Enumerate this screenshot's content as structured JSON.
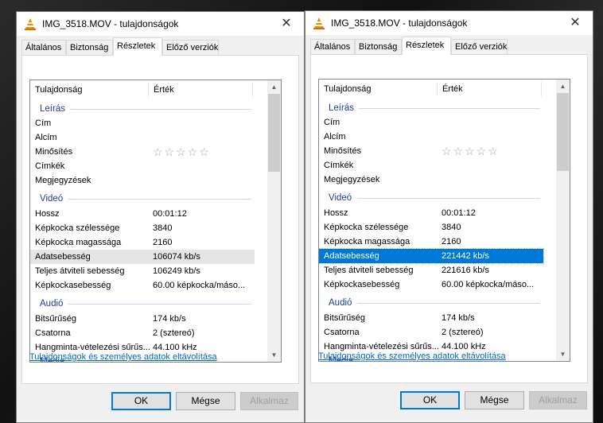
{
  "dialogs": [
    {
      "title": "IMG_3518.MOV - tulajdonságok",
      "close_glyph": "✕",
      "tabs": [
        "Általános",
        "Biztonság",
        "Részletek",
        "Előző verziók"
      ],
      "active_tab": "Részletek",
      "columns": [
        "Tulajdonság",
        "Érték"
      ],
      "groups": {
        "description": "Leírás",
        "video": "Videó",
        "audio": "Audió",
        "partial": "Media"
      },
      "description_rows": [
        {
          "key": "Cím",
          "value": ""
        },
        {
          "key": "Alcím",
          "value": ""
        },
        {
          "key": "Minősítés",
          "value": "☆☆☆☆☆"
        },
        {
          "key": "Címkék",
          "value": ""
        },
        {
          "key": "Megjegyzések",
          "value": ""
        }
      ],
      "video_rows": [
        {
          "key": "Hossz",
          "value": "00:01:12"
        },
        {
          "key": "Képkocka szélessége",
          "value": "3840"
        },
        {
          "key": "Képkocka magassága",
          "value": "2160"
        },
        {
          "key": "Adatsebesség",
          "value": "106074 kb/s"
        },
        {
          "key": "Teljes átviteli sebesség",
          "value": "106249 kb/s"
        },
        {
          "key": "Képkockasebesség",
          "value": "60.00 képkocka/máso..."
        }
      ],
      "audio_rows": [
        {
          "key": "Bitsűrűség",
          "value": "174 kb/s"
        },
        {
          "key": "Csatorna",
          "value": "2 (sztereó)"
        },
        {
          "key": "Hangminta-vételezési sűrűs...",
          "value": "44.100 kHz"
        }
      ],
      "link": "Tulajdonságok és személyes adatok eltávolítása",
      "buttons": {
        "ok": "OK",
        "cancel": "Mégse",
        "apply": "Alkalmaz"
      }
    },
    {
      "title": "IMG_3518.MOV - tulajdonságok",
      "close_glyph": "✕",
      "tabs": [
        "Általános",
        "Biztonság",
        "Részletek",
        "Előző verziók"
      ],
      "active_tab": "Részletek",
      "columns": [
        "Tulajdonság",
        "Érték"
      ],
      "groups": {
        "description": "Leírás",
        "video": "Videó",
        "audio": "Audió",
        "partial": "Media"
      },
      "description_rows": [
        {
          "key": "Cím",
          "value": ""
        },
        {
          "key": "Alcím",
          "value": ""
        },
        {
          "key": "Minősítés",
          "value": "☆☆☆☆☆"
        },
        {
          "key": "Címkék",
          "value": ""
        },
        {
          "key": "Megjegyzések",
          "value": ""
        }
      ],
      "video_rows": [
        {
          "key": "Hossz",
          "value": "00:01:12"
        },
        {
          "key": "Képkocka szélessége",
          "value": "3840"
        },
        {
          "key": "Képkocka magassága",
          "value": "2160"
        },
        {
          "key": "Adatsebesség",
          "value": "221442 kb/s"
        },
        {
          "key": "Teljes átviteli sebesség",
          "value": "221616 kb/s"
        },
        {
          "key": "Képkockasebesség",
          "value": "60.00 képkocka/máso..."
        }
      ],
      "audio_rows": [
        {
          "key": "Bitsűrűség",
          "value": "174 kb/s"
        },
        {
          "key": "Csatorna",
          "value": "2 (sztereó)"
        },
        {
          "key": "Hangminta-vételezési sűrűs...",
          "value": "44.100 kHz"
        }
      ],
      "link": "Tulajdonságok és személyes adatok eltávolítása",
      "buttons": {
        "ok": "OK",
        "cancel": "Mégse",
        "apply": "Alkalmaz"
      }
    }
  ],
  "colors": {
    "selection": "#0078d7",
    "group_header": "#1e3c9a",
    "link": "#0066cc",
    "vlc_orange": "#f08a00"
  }
}
